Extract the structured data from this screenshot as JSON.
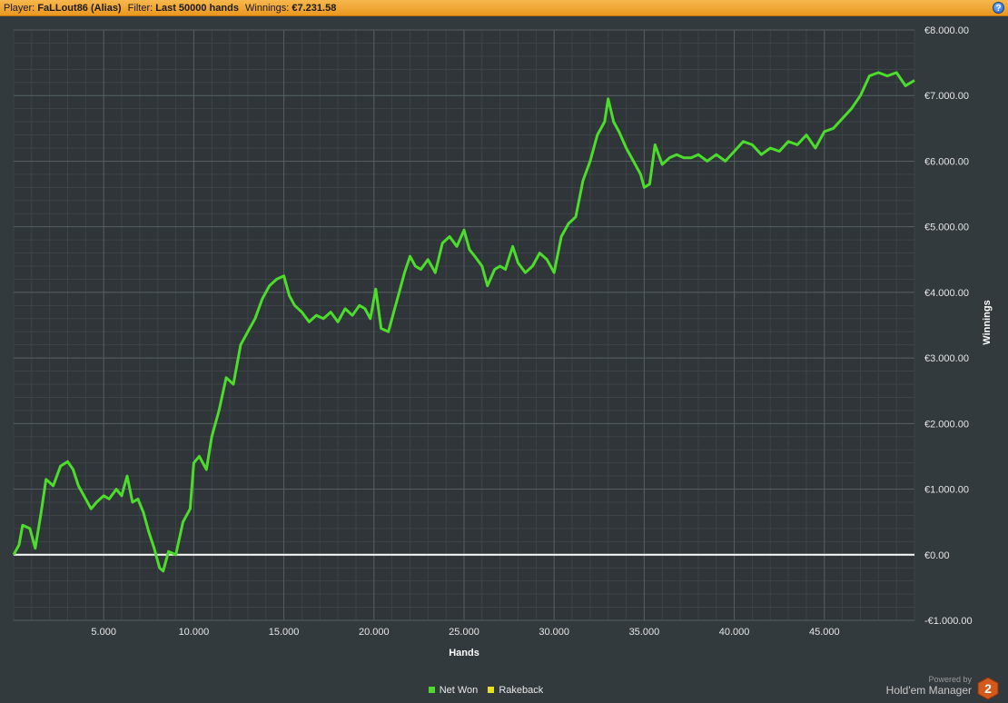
{
  "header": {
    "player_label": "Player:",
    "player_value": "FaLLout86 (Alias)",
    "filter_label": "Filter:",
    "filter_value": "Last 50000 hands",
    "winnings_label": "Winnings:",
    "winnings_value": "€7.231.58"
  },
  "help_icon": "?",
  "footer": {
    "powered_by": "Powered by",
    "brand": "Hold'em Manager",
    "brand_number": "2"
  },
  "colors": {
    "background": "#333a3d",
    "net_won": "#4cdd2c",
    "rakeback": "#e8e020",
    "zero_line": "#ffffff",
    "header": "#f0a030"
  },
  "chart_data": {
    "type": "line",
    "xlabel": "Hands",
    "ylabel": "Winnings",
    "xlim": [
      0,
      50000
    ],
    "ylim": [
      -1000,
      8000
    ],
    "x_ticks": [
      5000,
      10000,
      15000,
      20000,
      25000,
      30000,
      35000,
      40000,
      45000
    ],
    "x_tick_labels": [
      "5.000",
      "10.000",
      "15.000",
      "20.000",
      "25.000",
      "30.000",
      "35.000",
      "40.000",
      "45.000"
    ],
    "y_ticks": [
      -1000,
      0,
      1000,
      2000,
      3000,
      4000,
      5000,
      6000,
      7000,
      8000
    ],
    "y_tick_labels": [
      "-€1.000.00",
      "€0.00",
      "€1.000.00",
      "€2.000.00",
      "€3.000.00",
      "€4.000.00",
      "€5.000.00",
      "€6.000.00",
      "€7.000.00",
      "€8.000.00"
    ],
    "grid": true,
    "legend_position": "bottom",
    "series": [
      {
        "name": "Net Won",
        "x": [
          0,
          300,
          500,
          900,
          1200,
          1500,
          1800,
          2200,
          2600,
          3000,
          3300,
          3600,
          4000,
          4300,
          4600,
          5000,
          5300,
          5700,
          6000,
          6300,
          6600,
          6900,
          7200,
          7500,
          7800,
          8100,
          8300,
          8600,
          9000,
          9400,
          9800,
          10000,
          10300,
          10700,
          11000,
          11400,
          11800,
          12200,
          12600,
          13000,
          13400,
          13800,
          14200,
          14600,
          15000,
          15300,
          15600,
          16000,
          16400,
          16800,
          17200,
          17600,
          18000,
          18400,
          18800,
          19200,
          19500,
          19800,
          20100,
          20400,
          20800,
          21100,
          21400,
          21700,
          22000,
          22300,
          22600,
          23000,
          23400,
          23800,
          24200,
          24600,
          25000,
          25300,
          25600,
          26000,
          26300,
          26700,
          27000,
          27300,
          27700,
          28000,
          28400,
          28800,
          29200,
          29600,
          30000,
          30400,
          30800,
          31200,
          31600,
          32000,
          32400,
          32800,
          33000,
          33300,
          33600,
          34000,
          34400,
          34800,
          35000,
          35300,
          35600,
          36000,
          36400,
          36800,
          37200,
          37600,
          38000,
          38500,
          39000,
          39500,
          40000,
          40500,
          41000,
          41500,
          42000,
          42500,
          43000,
          43500,
          44000,
          44500,
          45000,
          45500,
          46000,
          46500,
          47000,
          47500,
          48000,
          48500,
          49000,
          49500,
          50000
        ],
        "y": [
          0,
          150,
          450,
          400,
          100,
          600,
          1150,
          1050,
          1350,
          1420,
          1300,
          1050,
          850,
          700,
          800,
          900,
          850,
          1000,
          900,
          1200,
          800,
          850,
          650,
          350,
          100,
          -200,
          -250,
          50,
          0,
          500,
          700,
          1400,
          1500,
          1300,
          1800,
          2200,
          2700,
          2600,
          3200,
          3400,
          3600,
          3900,
          4100,
          4200,
          4250,
          3950,
          3800,
          3700,
          3550,
          3650,
          3600,
          3700,
          3550,
          3750,
          3650,
          3800,
          3750,
          3600,
          4050,
          3450,
          3400,
          3700,
          4000,
          4300,
          4550,
          4400,
          4350,
          4500,
          4300,
          4750,
          4850,
          4700,
          4950,
          4650,
          4550,
          4400,
          4100,
          4350,
          4400,
          4350,
          4700,
          4450,
          4300,
          4400,
          4600,
          4500,
          4300,
          4850,
          5050,
          5150,
          5700,
          6000,
          6400,
          6600,
          6950,
          6600,
          6450,
          6200,
          6000,
          5800,
          5600,
          5650,
          6250,
          5950,
          6050,
          6100,
          6050,
          6050,
          6100,
          6000,
          6100,
          6000,
          6150,
          6300,
          6250,
          6100,
          6200,
          6150,
          6300,
          6250,
          6400,
          6200,
          6450,
          6500,
          6650,
          6800,
          7000,
          7300,
          7350,
          7300,
          7350,
          7150,
          7231
        ]
      },
      {
        "name": "Rakeback",
        "x": [],
        "y": []
      }
    ]
  }
}
